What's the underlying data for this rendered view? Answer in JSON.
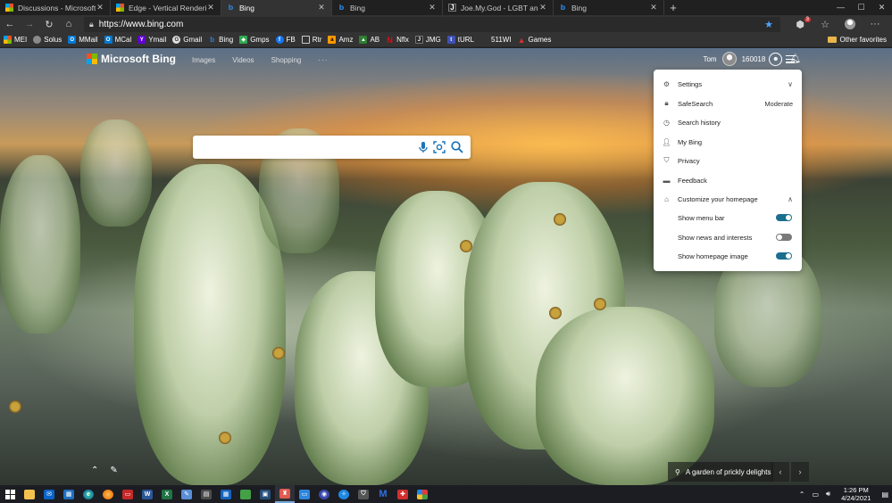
{
  "tabs": [
    {
      "title": "Discussions - Microsoft Tech Co",
      "icon": "microsoft-icon",
      "active": false
    },
    {
      "title": "Edge - Vertical Rendering Issue",
      "icon": "microsoft-icon",
      "active": false
    },
    {
      "title": "Bing",
      "icon": "bing-icon",
      "active": true
    },
    {
      "title": "Bing",
      "icon": "bing-icon",
      "active": false
    },
    {
      "title": "Joe.My.God - LGBT and political",
      "icon": "joemygod-icon",
      "active": false
    },
    {
      "title": "Bing",
      "icon": "bing-icon",
      "active": false
    }
  ],
  "address": {
    "url": "https://www.bing.com"
  },
  "toolbar": {
    "extension_badge": "3"
  },
  "favorites": {
    "items": [
      {
        "label": "MEI",
        "color": "#ff5722"
      },
      {
        "label": "Solus",
        "color": "#9e9e9e"
      },
      {
        "label": "MMail",
        "color": "#0078d4"
      },
      {
        "label": "MCal",
        "color": "#0078d4"
      },
      {
        "label": "Ymail",
        "color": "#6001d2"
      },
      {
        "label": "Gmail",
        "color": "#e0e0e0"
      },
      {
        "label": "Bing",
        "color": "#2f7fd9"
      },
      {
        "label": "Gmps",
        "color": "#34a853"
      },
      {
        "label": "FB",
        "color": "#1877f2"
      },
      {
        "label": "Rtr",
        "color": "#cccccc"
      },
      {
        "label": "Amz",
        "color": "#ff9900"
      },
      {
        "label": "AB",
        "color": "#2e7d32"
      },
      {
        "label": "Nflx",
        "color": "#e50914"
      },
      {
        "label": "JMG",
        "color": "#2b2b2b"
      },
      {
        "label": "tURL",
        "color": "#3f51b5"
      },
      {
        "label": "511WI",
        "color": "#333333"
      },
      {
        "label": "Games",
        "color": "#d32f2f"
      }
    ],
    "other": "Other favorites"
  },
  "bing": {
    "brand": "Microsoft Bing",
    "nav": [
      "Images",
      "Videos",
      "Shopping"
    ],
    "nav_more": "···",
    "user": "Tom",
    "points": "160018",
    "search_placeholder": ""
  },
  "settings_menu": {
    "items": [
      {
        "label": "Settings",
        "icon": "gear-icon",
        "trailing": "∨"
      },
      {
        "label": "SafeSearch",
        "icon": "lock-icon",
        "value": "Moderate"
      },
      {
        "label": "Search history",
        "icon": "clock-icon"
      },
      {
        "label": "My Bing",
        "icon": "person-icon"
      },
      {
        "label": "Privacy",
        "icon": "shield-icon"
      },
      {
        "label": "Feedback",
        "icon": "chat-icon"
      },
      {
        "label": "Customize your homepage",
        "icon": "home-icon",
        "trailing": "∧"
      }
    ],
    "toggles": [
      {
        "label": "Show menu bar",
        "on": true
      },
      {
        "label": "Show news and interests",
        "on": false
      },
      {
        "label": "Show homepage image",
        "on": true
      }
    ]
  },
  "caption": {
    "text": "A garden of prickly delights"
  },
  "taskbar": {
    "time": "1:26 PM",
    "date": "4/24/2021"
  }
}
